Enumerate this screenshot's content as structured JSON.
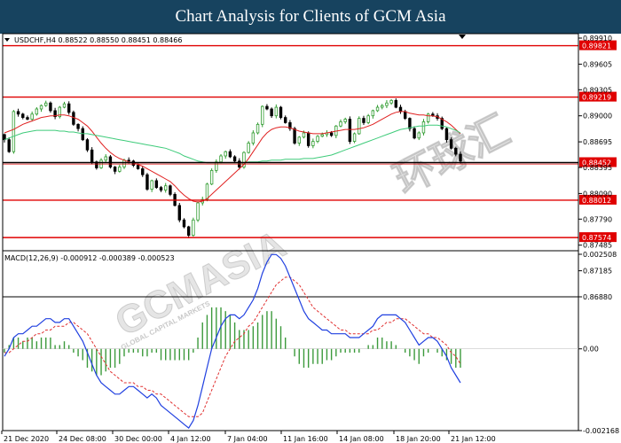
{
  "banner": {
    "title": "Chart Analysis for Clients of GCM Asia"
  },
  "watermark": {
    "brand": "GCMASIA",
    "chinese": "环球汇",
    "sub": "GLOBAL CAPITAL MARKETS"
  },
  "colors": {
    "banner": "#17435f",
    "candle_up": "#2e9b2e",
    "candle_down": "#000000",
    "ma_fast": "#e02020",
    "ma_slow": "#3ecb7a",
    "level": "#e00000",
    "macd_line": "#2040e0",
    "signal_line": "#e03030",
    "histogram": "#3c9a3c"
  },
  "chart_data": [
    {
      "type": "candlestick",
      "header": "USDCHF,H4  0.88522 0.88550 0.88451 0.88466",
      "symbol": "USDCHF",
      "timeframe": "H4",
      "ohlc_last": {
        "open": 0.88522,
        "high": 0.8855,
        "low": 0.88451,
        "close": 0.88466
      },
      "ylim": [
        0.8688,
        0.8991
      ],
      "y_ticks": [
        "0.89910",
        "0.89605",
        "0.89305",
        "0.89000",
        "0.88695",
        "0.88395",
        "0.88090",
        "0.87790",
        "0.87485",
        "0.87185",
        "0.86880"
      ],
      "levels": [
        {
          "value": 0.89821,
          "label": "0.89821"
        },
        {
          "value": 0.89219,
          "label": "0.89219"
        },
        {
          "value": 0.88452,
          "label": "0.88452"
        },
        {
          "value": 0.88012,
          "label": "0.88012"
        },
        {
          "value": 0.87574,
          "label": "0.87574"
        }
      ],
      "x_ticks": [
        "21 Dec 2020",
        "24 Dec 08:00",
        "30 Dec 00:00",
        "4 Jan 12:00",
        "7 Jan 04:00",
        "11 Jan 16:00",
        "14 Jan 08:00",
        "18 Jan 20:00",
        "21 Jan 12:00"
      ],
      "closes": [
        0.8872,
        0.8858,
        0.8905,
        0.8902,
        0.8898,
        0.8896,
        0.8902,
        0.8908,
        0.8912,
        0.8915,
        0.8906,
        0.8899,
        0.891,
        0.8914,
        0.8904,
        0.889,
        0.8885,
        0.8872,
        0.886,
        0.8846,
        0.8839,
        0.8848,
        0.8852,
        0.884,
        0.8835,
        0.884,
        0.8848,
        0.8847,
        0.8842,
        0.8838,
        0.8831,
        0.8814,
        0.8824,
        0.8816,
        0.8813,
        0.8818,
        0.8808,
        0.8795,
        0.8778,
        0.877,
        0.876,
        0.8778,
        0.8798,
        0.8802,
        0.882,
        0.8836,
        0.8846,
        0.8853,
        0.8858,
        0.8852,
        0.8847,
        0.884,
        0.8857,
        0.8868,
        0.888,
        0.889,
        0.8911,
        0.8908,
        0.89,
        0.891,
        0.8898,
        0.8892,
        0.8885,
        0.8868,
        0.8875,
        0.888,
        0.8865,
        0.887,
        0.8876,
        0.8878,
        0.888,
        0.8877,
        0.8888,
        0.8893,
        0.8896,
        0.887,
        0.8879,
        0.8897,
        0.8892,
        0.89,
        0.8906,
        0.891,
        0.8912,
        0.8915,
        0.8918,
        0.891,
        0.8905,
        0.8897,
        0.8885,
        0.8874,
        0.888,
        0.8893,
        0.8902,
        0.89,
        0.8897,
        0.8885,
        0.8872,
        0.8862,
        0.8855,
        0.8847
      ],
      "series": [
        {
          "name": "MA fast",
          "values": [
            0.888,
            0.8882,
            0.8884,
            0.8887,
            0.889,
            0.8892,
            0.8894,
            0.8896,
            0.8898,
            0.8899,
            0.89,
            0.89,
            0.8901,
            0.8901,
            0.89,
            0.8898,
            0.8896,
            0.8892,
            0.8888,
            0.8882,
            0.8875,
            0.8868,
            0.8862,
            0.8857,
            0.8853,
            0.885,
            0.8848,
            0.8846,
            0.8845,
            0.8843,
            0.8841,
            0.8838,
            0.8835,
            0.8832,
            0.8829,
            0.8826,
            0.8823,
            0.8818,
            0.8812,
            0.8807,
            0.8803,
            0.88,
            0.8799,
            0.88,
            0.8803,
            0.8808,
            0.8813,
            0.8818,
            0.8823,
            0.8828,
            0.8833,
            0.8838,
            0.8843,
            0.885,
            0.8858,
            0.8866,
            0.8874,
            0.888,
            0.8884,
            0.8886,
            0.8887,
            0.8887,
            0.8886,
            0.8884,
            0.8882,
            0.8881,
            0.888,
            0.8879,
            0.8879,
            0.8879,
            0.888,
            0.8881,
            0.8882,
            0.8883,
            0.8884,
            0.8884,
            0.8884,
            0.8885,
            0.8886,
            0.8888,
            0.889,
            0.8893,
            0.8896,
            0.8899,
            0.8902,
            0.8904,
            0.8905,
            0.8905,
            0.8903,
            0.8902,
            0.8901,
            0.8901,
            0.89,
            0.89,
            0.8899,
            0.8896,
            0.8893,
            0.8889,
            0.8884,
            0.8879
          ]
        },
        {
          "name": "MA slow",
          "values": [
            0.8872,
            0.8874,
            0.8876,
            0.8878,
            0.888,
            0.8881,
            0.8882,
            0.8883,
            0.8883,
            0.8883,
            0.8883,
            0.8883,
            0.8882,
            0.8882,
            0.8881,
            0.8881,
            0.888,
            0.8879,
            0.8879,
            0.8878,
            0.8877,
            0.8876,
            0.8875,
            0.8874,
            0.8873,
            0.8872,
            0.8871,
            0.887,
            0.8869,
            0.8868,
            0.8867,
            0.8866,
            0.8865,
            0.8864,
            0.8863,
            0.8862,
            0.886,
            0.8858,
            0.8856,
            0.8853,
            0.8851,
            0.8849,
            0.8847,
            0.8846,
            0.8845,
            0.8845,
            0.8845,
            0.8845,
            0.8845,
            0.8845,
            0.8845,
            0.8845,
            0.8845,
            0.8846,
            0.8846,
            0.8846,
            0.8847,
            0.8847,
            0.8848,
            0.8848,
            0.8848,
            0.8849,
            0.8849,
            0.8849,
            0.8849,
            0.885,
            0.885,
            0.885,
            0.8851,
            0.8852,
            0.8853,
            0.8854,
            0.8856,
            0.8858,
            0.886,
            0.8862,
            0.8864,
            0.8866,
            0.8868,
            0.887,
            0.8872,
            0.8874,
            0.8876,
            0.8878,
            0.888,
            0.8882,
            0.8884,
            0.8885,
            0.8886,
            0.8887,
            0.8888,
            0.8888,
            0.8889,
            0.8889,
            0.8889,
            0.8888,
            0.8887,
            0.8885,
            0.8883,
            0.888
          ]
        }
      ]
    },
    {
      "type": "line",
      "header": "MACD(12,26,9) -0.000912 -0.000389 -0.000523",
      "params": "12,26,9",
      "last_values": {
        "macd": -0.000912,
        "signal": -0.000389,
        "histogram": -0.000523
      },
      "ylim": [
        -0.002168,
        0.002508
      ],
      "y_ticks": [
        "0.002508",
        "0.00",
        "-0.002168"
      ],
      "series": [
        {
          "name": "MACD",
          "values": [
            -0.0002,
            0.0,
            0.0003,
            0.0004,
            0.0004,
            0.0005,
            0.0006,
            0.0006,
            0.0007,
            0.0008,
            0.0008,
            0.0007,
            0.0007,
            0.0008,
            0.0008,
            0.0006,
            0.0004,
            0.0002,
            -0.0001,
            -0.0004,
            -0.0007,
            -0.0009,
            -0.001,
            -0.0011,
            -0.0012,
            -0.0012,
            -0.0011,
            -0.001,
            -0.001,
            -0.0011,
            -0.0012,
            -0.0013,
            -0.0012,
            -0.0013,
            -0.0015,
            -0.0016,
            -0.0017,
            -0.0018,
            -0.0019,
            -0.002,
            -0.0021,
            -0.0019,
            -0.0015,
            -0.001,
            -0.0005,
            0.0,
            0.0003,
            0.0006,
            0.0008,
            0.0009,
            0.0009,
            0.0008,
            0.0009,
            0.0011,
            0.0013,
            0.0016,
            0.002,
            0.0023,
            0.0025,
            0.0025,
            0.0024,
            0.0022,
            0.0019,
            0.0016,
            0.0013,
            0.001,
            0.0008,
            0.0007,
            0.0006,
            0.0005,
            0.0005,
            0.0004,
            0.0004,
            0.0004,
            0.0004,
            0.0003,
            0.0003,
            0.0003,
            0.0004,
            0.0005,
            0.0006,
            0.0008,
            0.0009,
            0.0009,
            0.0009,
            0.0009,
            0.0008,
            0.0007,
            0.0005,
            0.0003,
            0.0001,
            0.0002,
            0.0003,
            0.0003,
            0.0002,
            0.0,
            -0.0002,
            -0.0005,
            -0.0007,
            -0.0009
          ]
        },
        {
          "name": "Signal",
          "values": [
            -0.0001,
            -0.0001,
            0.0,
            0.0001,
            0.0002,
            0.0002,
            0.0003,
            0.0004,
            0.0004,
            0.0005,
            0.0005,
            0.0006,
            0.0006,
            0.0006,
            0.0007,
            0.0007,
            0.0006,
            0.0005,
            0.0004,
            0.0002,
            0.0,
            -0.0002,
            -0.0004,
            -0.0006,
            -0.0007,
            -0.0008,
            -0.0009,
            -0.0009,
            -0.0009,
            -0.001,
            -0.001,
            -0.0011,
            -0.0011,
            -0.0012,
            -0.0012,
            -0.0013,
            -0.0014,
            -0.0015,
            -0.0016,
            -0.0017,
            -0.0018,
            -0.0018,
            -0.0018,
            -0.0017,
            -0.0014,
            -0.0011,
            -0.0008,
            -0.0005,
            -0.0002,
            0.0,
            0.0002,
            0.0003,
            0.0004,
            0.0006,
            0.0007,
            0.0009,
            0.0011,
            0.0013,
            0.0015,
            0.0017,
            0.0018,
            0.0019,
            0.0019,
            0.0018,
            0.0017,
            0.0015,
            0.0013,
            0.0011,
            0.001,
            0.0009,
            0.0008,
            0.0007,
            0.0006,
            0.0005,
            0.0005,
            0.0004,
            0.0004,
            0.0004,
            0.0004,
            0.0004,
            0.0005,
            0.0005,
            0.0006,
            0.0007,
            0.0007,
            0.0008,
            0.0008,
            0.0008,
            0.0007,
            0.0006,
            0.0005,
            0.0004,
            0.0004,
            0.0003,
            0.0003,
            0.0002,
            0.0001,
            -0.0001,
            -0.0002,
            -0.0004
          ]
        }
      ]
    }
  ]
}
